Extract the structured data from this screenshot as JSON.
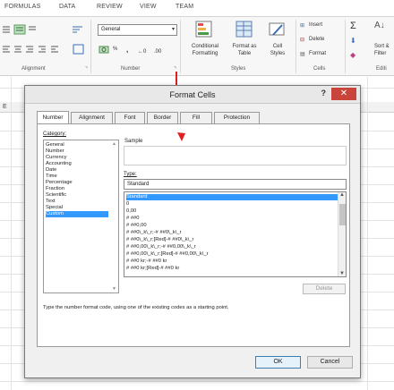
{
  "ribbon": {
    "tabs": [
      "FORMULAS",
      "DATA",
      "REVIEW",
      "VIEW",
      "TEAM"
    ],
    "number_format_value": "General",
    "percent_symbol": "%",
    "comma_symbol": ",",
    "conditional_label": "Conditional",
    "formatting_label": "Formatting",
    "format_as_label": "Format as",
    "table_label": "Table",
    "cell_label": "Cell",
    "styles_btn_label": "Styles",
    "insert_label": "Insert",
    "delete_label": "Delete",
    "format_label": "Format",
    "sort_label": "Sort &",
    "filter_label": "Filter",
    "groups": {
      "alignment": "Alignment",
      "number": "Number",
      "styles": "Styles",
      "cells": "Cells",
      "editing": "Editi"
    }
  },
  "sheet": {
    "col_e": "E"
  },
  "dialog": {
    "title": "Format Cells",
    "help": "?",
    "close": "✕",
    "tabs": [
      "Number",
      "Alignment",
      "Font",
      "Border",
      "Fill",
      "Protection"
    ],
    "category_label": "Category:",
    "categories": [
      "General",
      "Number",
      "Currency",
      "Accounting",
      "Date",
      "Time",
      "Percentage",
      "Fraction",
      "Scientific",
      "Text",
      "Special",
      "Custom"
    ],
    "selected_category": "Custom",
    "sample_label": "Sample",
    "type_label": "Type:",
    "type_value": "Standard",
    "type_list": [
      "Standard",
      "0",
      "0,00",
      "# ##0",
      "# ##0,00",
      "# ##0\\_k\\_r;-# ##0\\_k\\_r",
      "# ##0\\_k\\_r;[Red]-# ##0\\_k\\_r",
      "# ##0,00\\_k\\_r;-# ##0,00\\_k\\_r",
      "# ##0,00\\_k\\_r;[Red]-# ##0,00\\_k\\_r",
      "# ##0 kr;-# ##0 kr",
      "# ##0 kr;[Red]-# ##0 kr"
    ],
    "delete_button": "Delete",
    "description": "Type the number format code, using one of the existing codes as a starting point.",
    "ok_button": "OK",
    "cancel_button": "Cancel"
  },
  "colors": {
    "selection": "#3399ff",
    "close": "#c9453b",
    "annotation": "#e02020"
  }
}
